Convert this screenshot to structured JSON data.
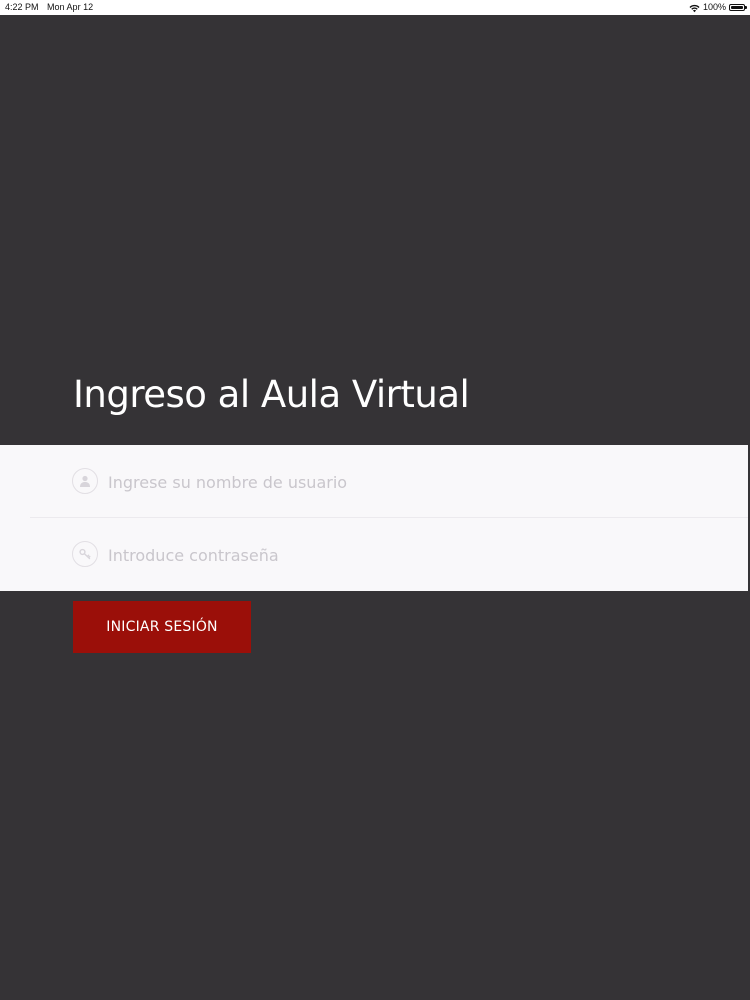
{
  "status_bar": {
    "time": "4:22 PM",
    "date": "Mon Apr 12",
    "battery": "100%",
    "wifi_icon": "wifi-icon",
    "battery_icon": "battery-icon"
  },
  "login": {
    "title": "Ingreso al Aula Virtual",
    "username": {
      "placeholder": "Ingrese su nombre de usuario",
      "value": "",
      "icon": "user-icon"
    },
    "password": {
      "placeholder": "Introduce contraseña",
      "value": "",
      "icon": "key-icon"
    },
    "submit_label": "INICIAR SESIÓN"
  },
  "colors": {
    "background": "#353336",
    "form_panel": "#f9f8fa",
    "button": "#9b0f09",
    "title_text": "#ffffff",
    "placeholder_text": "#c9c6cc"
  }
}
